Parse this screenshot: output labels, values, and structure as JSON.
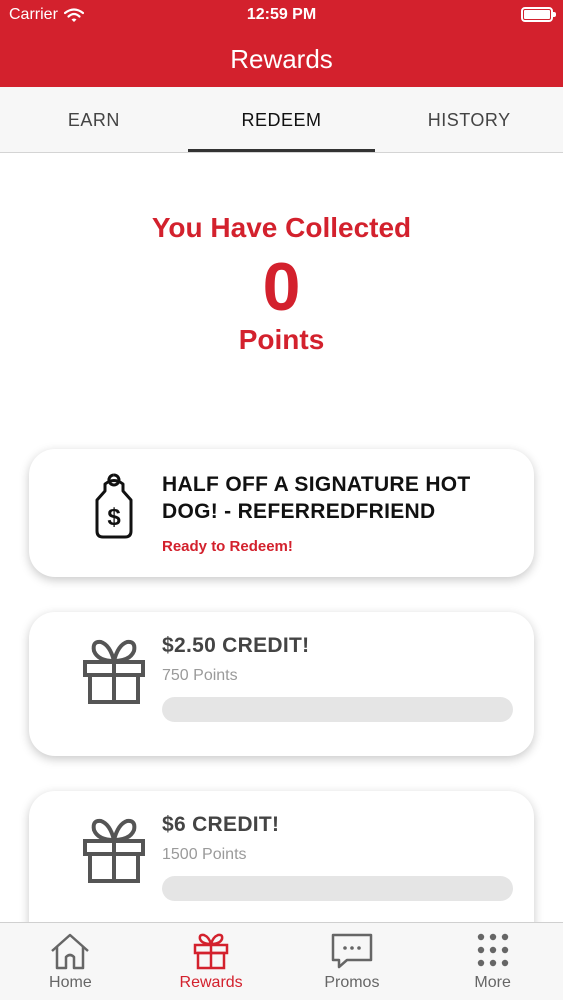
{
  "status_bar": {
    "carrier": "Carrier",
    "time": "12:59 PM"
  },
  "header": {
    "title": "Rewards"
  },
  "tabs": [
    {
      "label": "EARN",
      "active": false
    },
    {
      "label": "REDEEM",
      "active": true
    },
    {
      "label": "HISTORY",
      "active": false
    }
  ],
  "summary": {
    "title": "You Have Collected",
    "points": "0",
    "unit": "Points"
  },
  "rewards": [
    {
      "title": "HALF OFF A SIGNATURE HOT DOG! - REFERREDFRIEND",
      "status": "Ready to Redeem!",
      "icon": "price-tag-icon"
    },
    {
      "title": "$2.50 CREDIT!",
      "points": "750 Points",
      "progress": 0,
      "icon": "gift-icon"
    },
    {
      "title": "$6 CREDIT!",
      "points": "1500 Points",
      "progress": 0,
      "icon": "gift-icon"
    }
  ],
  "tabbar": [
    {
      "label": "Home",
      "icon": "home-icon",
      "active": false
    },
    {
      "label": "Rewards",
      "icon": "gift-icon",
      "active": true
    },
    {
      "label": "Promos",
      "icon": "chat-bubble-icon",
      "active": false
    },
    {
      "label": "More",
      "icon": "grid-dots-icon",
      "active": false
    }
  ],
  "colors": {
    "brand": "#d3212d",
    "icon_gray": "#555555"
  }
}
